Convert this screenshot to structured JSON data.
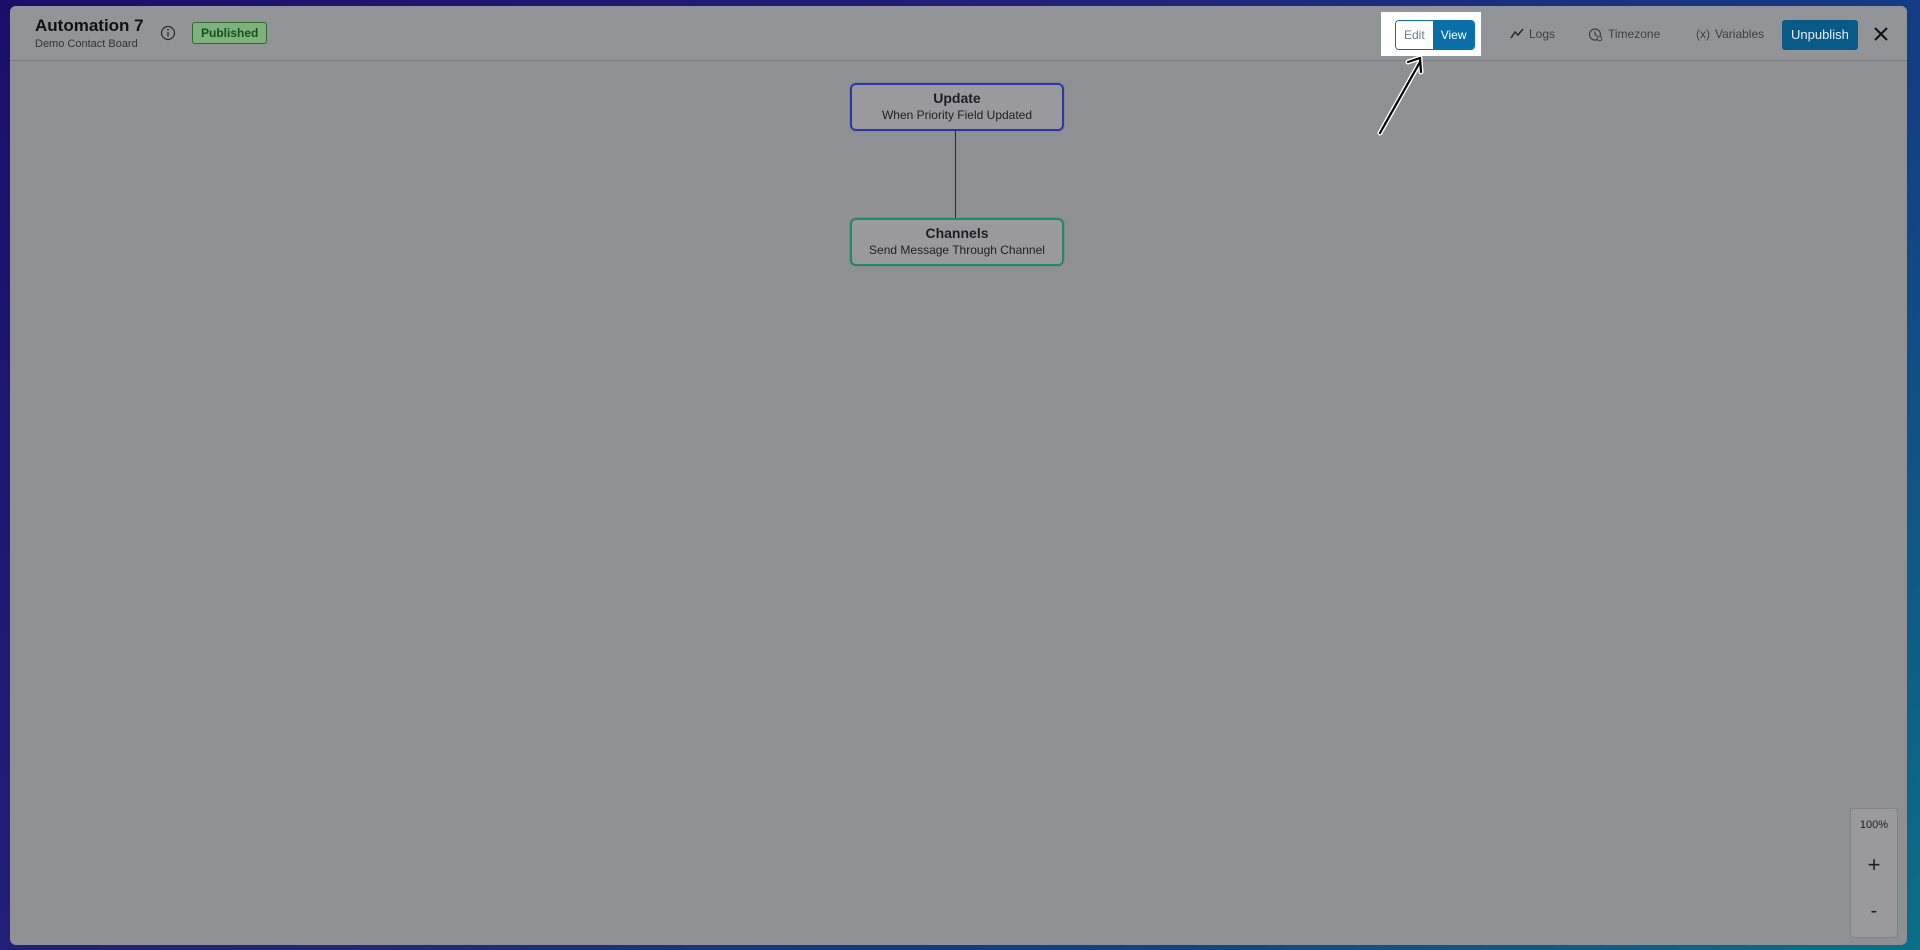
{
  "header": {
    "title": "Automation 7",
    "subtitle": "Demo Contact Board",
    "status_badge": "Published",
    "mode_toggle": {
      "edit_label": "Edit",
      "view_label": "View",
      "active": "View"
    },
    "logs_label": "Logs",
    "timezone_label": "Timezone",
    "variables_label": "Variables",
    "unpublish_label": "Unpublish",
    "icons": {
      "info": "info-icon",
      "logs": "activity-line-icon",
      "timezone": "clock-globe-icon",
      "variables": "variable-x-icon",
      "close": "close-icon"
    }
  },
  "canvas": {
    "nodes": [
      {
        "title": "Update",
        "subtitle": "When Priority Field Updated",
        "border_color": "#2d36a8"
      },
      {
        "title": "Channels",
        "subtitle": "Send Message Through Channel",
        "border_color": "#1a8c68"
      }
    ]
  },
  "zoom": {
    "level": "100%",
    "zoom_in_label": "+",
    "zoom_out_label": "-"
  },
  "colors": {
    "accent": "#0a6ea8",
    "badge_text": "#11551a"
  }
}
